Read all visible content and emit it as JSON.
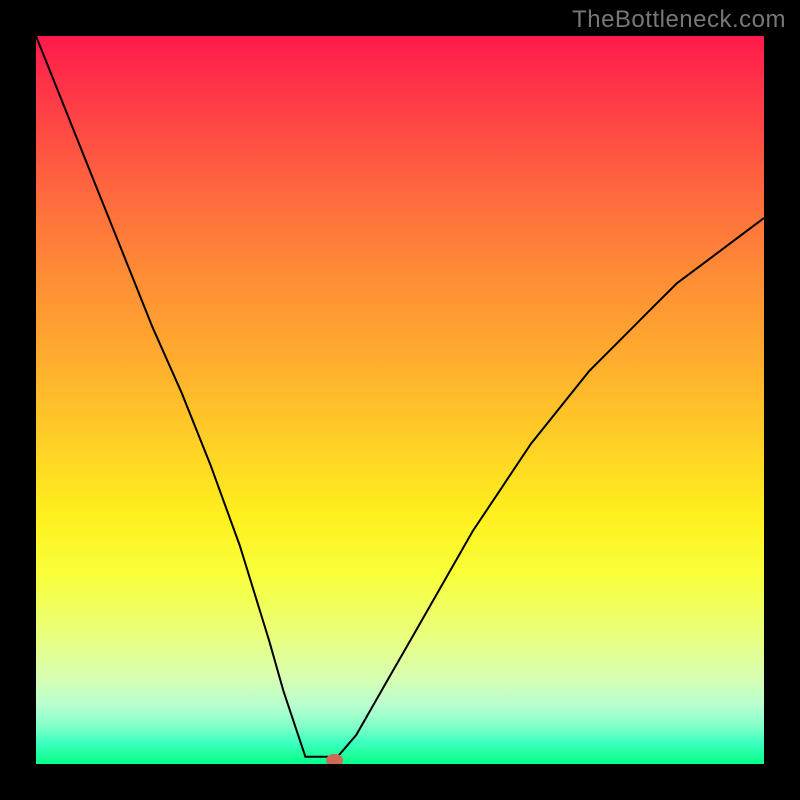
{
  "watermark": "TheBottleneck.com",
  "colors": {
    "frame": "#000000",
    "curve": "#000000",
    "marker": "#cc6a55",
    "gradient_stops": [
      "#ff1a4b",
      "#ff3f46",
      "#ff6a3e",
      "#ff8a36",
      "#ffab2e",
      "#ffd026",
      "#fff01e",
      "#f8ff3a",
      "#eaff7a",
      "#d8ffb0",
      "#b8ffd0",
      "#7dffc8",
      "#3effc0",
      "#1aff9a",
      "#00ff88"
    ]
  },
  "chart_data": {
    "type": "line",
    "title": "",
    "xlabel": "",
    "ylabel": "",
    "xlim": [
      0,
      100
    ],
    "ylim": [
      0,
      100
    ],
    "series": [
      {
        "name": "bottleneck-curve",
        "x": [
          0,
          4,
          8,
          12,
          16,
          20,
          24,
          28,
          32,
          34,
          36,
          37,
          38,
          40,
          41,
          44,
          48,
          52,
          56,
          60,
          64,
          68,
          72,
          76,
          80,
          84,
          88,
          92,
          96,
          100
        ],
        "y": [
          100,
          90,
          80,
          70,
          60,
          51,
          41,
          30,
          17,
          10,
          4,
          1,
          1,
          1,
          0.5,
          4,
          11,
          18,
          25,
          32,
          38,
          44,
          49,
          54,
          58,
          62,
          66,
          69,
          72,
          75
        ]
      }
    ],
    "marker": {
      "x": 41,
      "y": 0.5
    },
    "annotations": []
  }
}
